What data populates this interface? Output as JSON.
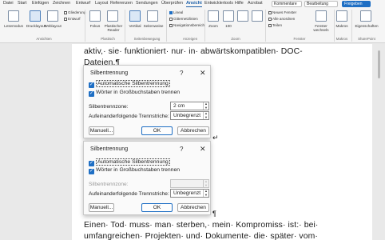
{
  "ribbon": {
    "tabs": [
      "Datei",
      "Start",
      "Einfügen",
      "Zeichnen",
      "Entwurf",
      "Layout",
      "Referenzen",
      "Sendungen",
      "Überprüfen",
      "Ansicht",
      "Entwicklertools",
      "Hilfe",
      "Acrobat"
    ],
    "active_tab": "Ansicht",
    "comments_button": "Kommentare",
    "editing_button": "Bearbeitung",
    "share_button": "Freigeben",
    "views": [
      "Lesemodus",
      "Drucklayout",
      "Weblayout"
    ],
    "gliederung": "Gliederung",
    "entwurf": "Entwurf",
    "immersive": [
      "Fokus",
      "Plastischer Reader"
    ],
    "page_move": [
      "Vertikal",
      "Seitenweise"
    ],
    "show": [
      "Lineal",
      "Gitternetzlinien",
      "Navigationsbereich"
    ],
    "zoom": "Zoom",
    "zoom_100": "100",
    "window": [
      "Neues Fenster",
      "Alle anordnen",
      "Teilen"
    ],
    "switch_window": "Fenster wechseln",
    "macros": "Makros",
    "properties": "Eigenschaften",
    "groups": [
      "Ansichten",
      "Plastisch",
      "Seitenbewegung",
      "Anzeigen",
      "Zoom",
      "Fenster",
      "Makros",
      "SharePoint"
    ]
  },
  "document": {
    "line1": "aktiv,· sie· funktioniert· nur· in· abwärtskompatiblen· DOC-",
    "line2": "Dateien.¶",
    "line3": "Einen· Tod· muss· man· sterben,· mein· Kompromiss· ist:· bei·",
    "line4": "umfangreichen· Projekten· und· Dokumente· die· später· vom·",
    "pilcrow": "¶",
    "return_mark": "↵"
  },
  "dialog1": {
    "title": "Silbentrennung",
    "help": "?",
    "close": "✕",
    "auto_label": "Automatische Silbentrennung",
    "caps_label": "Wörter in Großbuchstaben trennen",
    "zone_label": "Silbentrennzone:",
    "zone_value": "2 cm",
    "consec_label": "Aufeinanderfolgende Trennstriche:",
    "consec_value": "Unbegrenzt",
    "manual_button": "Manuell...",
    "ok_button": "OK",
    "cancel_button": "Abbrechen"
  },
  "dialog2": {
    "title": "Silbentrennung",
    "help": "?",
    "close": "✕",
    "auto_label": "Automatische Silbentrennung",
    "caps_label": "Wörter in Großbuchstaben trennen",
    "zone_label": "Silbentrennzone:",
    "zone_value": "",
    "consec_label": "Aufeinanderfolgende Trennstriche:",
    "consec_value": "Unbegrenzt",
    "manual_button": "Manuell...",
    "ok_button": "OK",
    "cancel_button": "Abbrechen"
  },
  "colors": {
    "accent": "#1f6fc4",
    "ribbon": "#f5f5f5",
    "page": "#ffffff",
    "workspace": "#e9e9e9"
  }
}
